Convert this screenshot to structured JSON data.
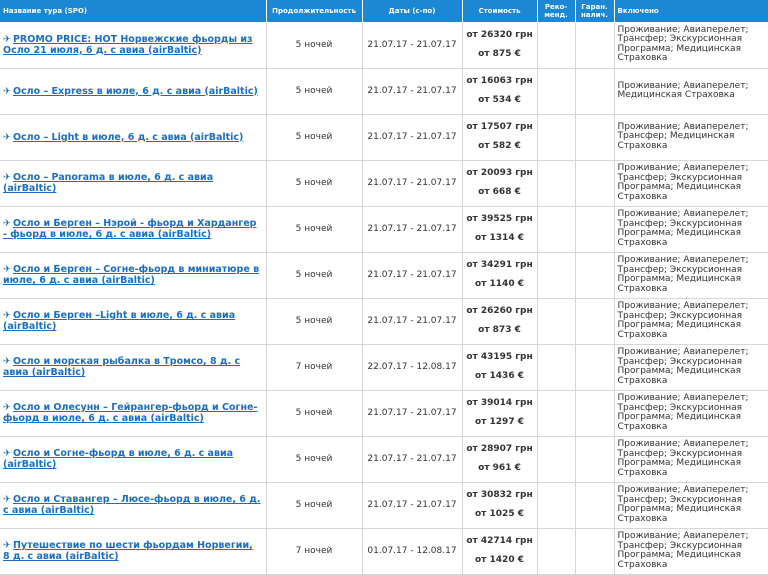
{
  "headers": {
    "name": "Название тура (SPO)",
    "duration": "Продолжительность",
    "dates": "Даты (с-по)",
    "price": "Стоимость",
    "recommended": "Реко-менд.",
    "guaranteed": "Гаран. налич.",
    "included": "Включено"
  },
  "icons": {
    "plane": "✈"
  },
  "colors": {
    "header_bg": "#1b87d5",
    "link": "#1a6fc4"
  },
  "rows": [
    {
      "name": "PROMO PRICE: HOT Норвежские фьорды из Осло 21 июля, 6 д. с авиа (airBaltic)",
      "duration": "5 ночей",
      "dates": "21.07.17 - 21.07.17",
      "price_uah": "от 26320 грн",
      "price_eur": "от 875 €",
      "included": "Проживание; Авиаперелет; Трансфер; Экскурсионная Программа; Медицинская Страховка"
    },
    {
      "name": "Осло – Express в июле, 6 д. с авиа (airBaltic)",
      "duration": "5 ночей",
      "dates": "21.07.17 - 21.07.17",
      "price_uah": "от 16063 грн",
      "price_eur": "от 534 €",
      "included": "Проживание; Авиаперелет; Медицинская Страховка"
    },
    {
      "name": "Осло – Light в июле, 6 д. с авиа (airBaltic)",
      "duration": "5 ночей",
      "dates": "21.07.17 - 21.07.17",
      "price_uah": "от 17507 грн",
      "price_eur": "от 582 €",
      "included": "Проживание; Авиаперелет; Трансфер; Медицинская Страховка"
    },
    {
      "name": "Осло – Panorama в июле, 6 д. с авиа (airBaltic)",
      "duration": "5 ночей",
      "dates": "21.07.17 - 21.07.17",
      "price_uah": "от 20093 грн",
      "price_eur": "от 668 €",
      "included": "Проживание; Авиаперелет; Трансфер; Экскурсионная Программа; Медицинская Страховка"
    },
    {
      "name": "Осло и Берген – Нэрой - фьорд и Хардангер - фьорд в июле, 6 д. с авиа (airBaltic)",
      "duration": "5 ночей",
      "dates": "21.07.17 - 21.07.17",
      "price_uah": "от 39525 грн",
      "price_eur": "от 1314 €",
      "included": "Проживание; Авиаперелет; Трансфер; Экскурсионная Программа; Медицинская Страховка"
    },
    {
      "name": "Осло и Берген – Согне-фьорд в миниатюре в июле, 6 д. с авиа (airBaltic)",
      "duration": "5 ночей",
      "dates": "21.07.17 - 21.07.17",
      "price_uah": "от 34291 грн",
      "price_eur": "от 1140 €",
      "included": "Проживание; Авиаперелет; Трансфер; Экскурсионная Программа; Медицинская Страховка"
    },
    {
      "name": "Осло и Берген –Light в июле, 6 д. с авиа (airBaltic)",
      "duration": "5 ночей",
      "dates": "21.07.17 - 21.07.17",
      "price_uah": "от 26260 грн",
      "price_eur": "от 873 €",
      "included": "Проживание; Авиаперелет; Трансфер; Экскурсионная Программа; Медицинская Страховка"
    },
    {
      "name": "Осло и морская рыбалка в Тромсо, 8 д. с авиа (airBaltic)",
      "duration": "7 ночей",
      "dates": "22.07.17 - 12.08.17",
      "price_uah": "от 43195 грн",
      "price_eur": "от 1436 €",
      "included": "Проживание; Авиаперелет; Трансфер; Экскурсионная Программа; Медицинская Страховка"
    },
    {
      "name": "Осло и Олесунн – Гейрангер-фьорд и Согне-фьорд в июле, 6 д. с авиа (airBaltic)",
      "duration": "5 ночей",
      "dates": "21.07.17 - 21.07.17",
      "price_uah": "от 39014 грн",
      "price_eur": "от 1297 €",
      "included": "Проживание; Авиаперелет; Трансфер; Экскурсионная Программа; Медицинская Страховка"
    },
    {
      "name": "Осло и Согне-фьорд в июле, 6 д. с авиа (airBaltic)",
      "duration": "5 ночей",
      "dates": "21.07.17 - 21.07.17",
      "price_uah": "от 28907 грн",
      "price_eur": "от 961 €",
      "included": "Проживание; Авиаперелет; Трансфер; Экскурсионная Программа; Медицинская Страховка"
    },
    {
      "name": "Осло и Ставангер – Люсе-фьорд в июле, 6 д. с авиа (airBaltic)",
      "duration": "5 ночей",
      "dates": "21.07.17 - 21.07.17",
      "price_uah": "от 30832 грн",
      "price_eur": "от 1025 €",
      "included": "Проживание; Авиаперелет; Трансфер; Экскурсионная Программа; Медицинская Страховка"
    },
    {
      "name": "Путешествие по шести фьордам Норвегии, 8 д. с авиа (airBaltic)",
      "duration": "7 ночей",
      "dates": "01.07.17 - 12.08.17",
      "price_uah": "от 42714 грн",
      "price_eur": "от 1420 €",
      "included": "Проживание; Авиаперелет; Трансфер; Экскурсионная Программа; Медицинская Страховка"
    }
  ]
}
